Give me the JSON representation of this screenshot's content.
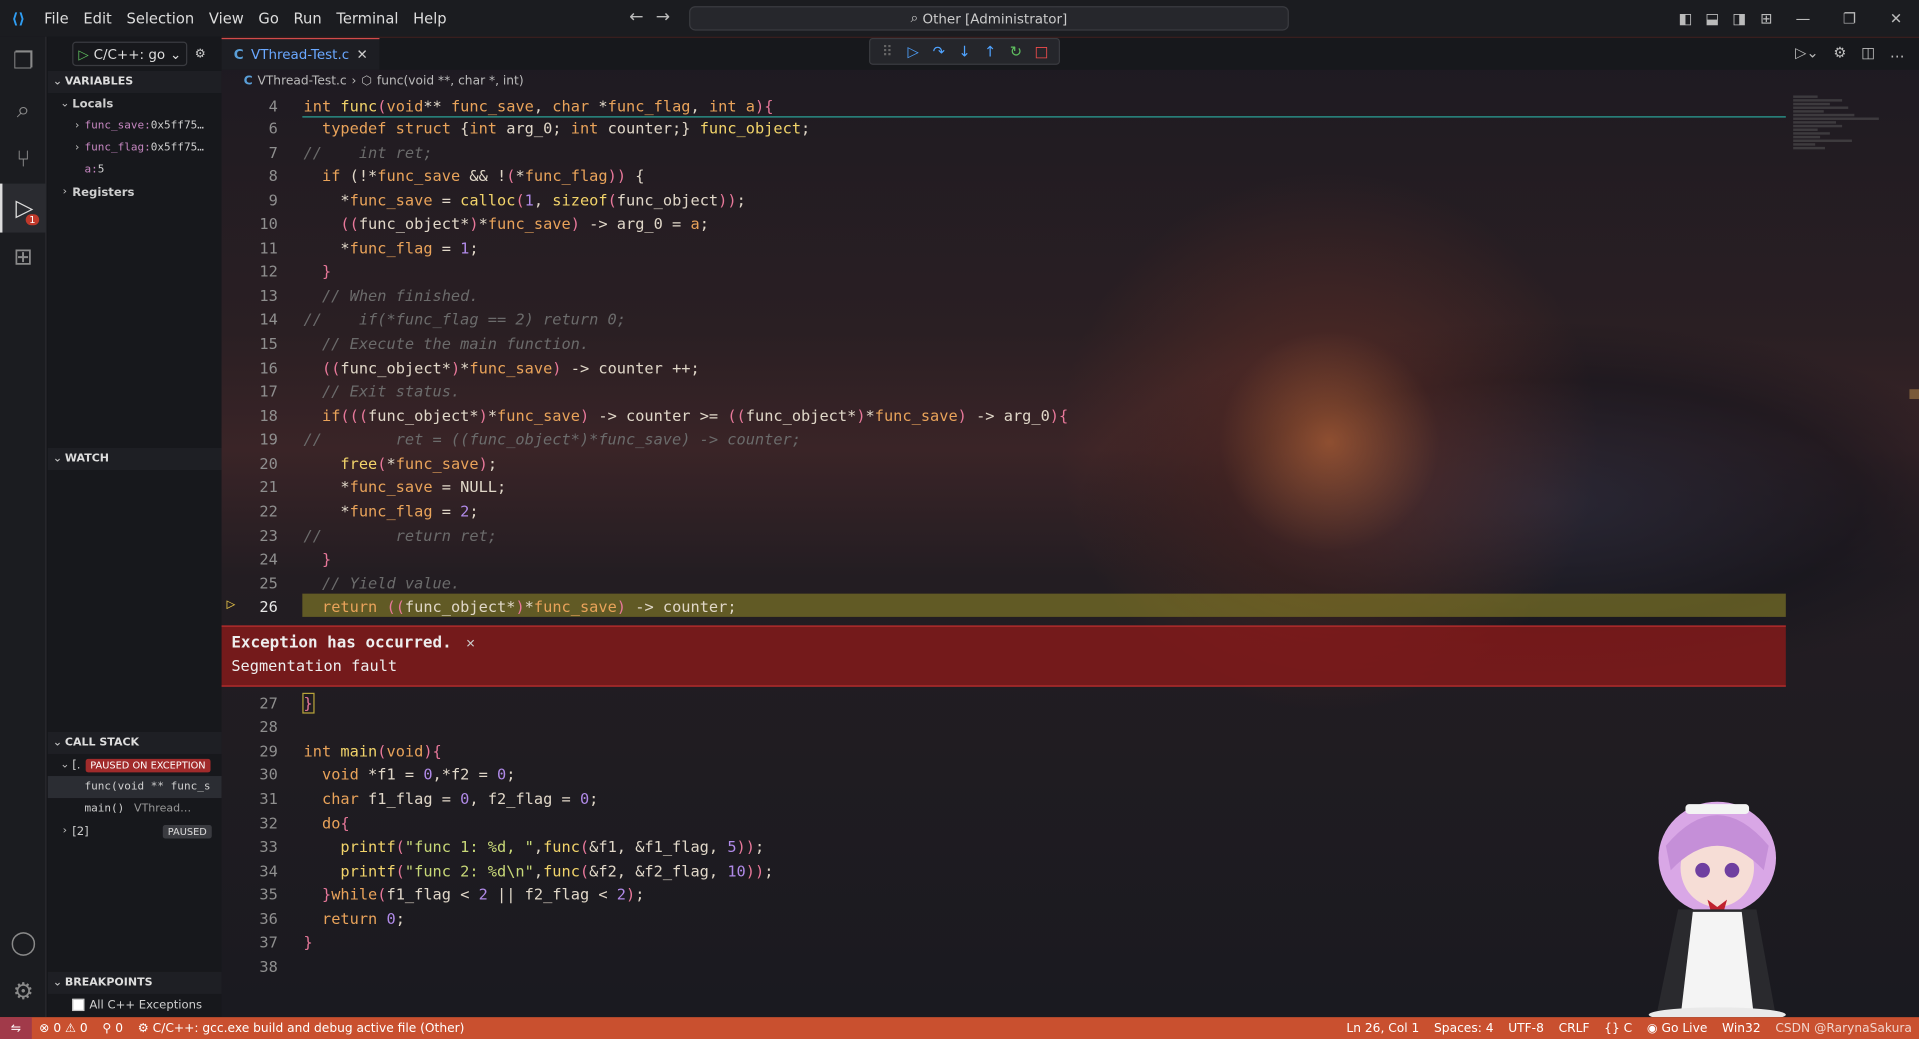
{
  "titlebar": {
    "menu": [
      "File",
      "Edit",
      "Selection",
      "View",
      "Go",
      "Run",
      "Terminal",
      "Help"
    ],
    "command_center": "Other [Administrator]"
  },
  "sidebar": {
    "run_config": "C/C++: go",
    "variables_header": "VARIABLES",
    "locals_label": "Locals",
    "vars": [
      {
        "name": "func_save:",
        "value": " 0x5ff75…"
      },
      {
        "name": "func_flag:",
        "value": " 0x5ff75…"
      },
      {
        "name": "a:",
        "value": " 5"
      }
    ],
    "registers_label": "Registers",
    "watch_header": "WATCH",
    "callstack_header": "CALL STACK",
    "thread1_label": "[.",
    "thread1_badge": "PAUSED ON EXCEPTION",
    "frame1": "func(void ** func_s",
    "frame2_name": "main()",
    "frame2_file": "VThread…",
    "thread2_label": "[2]",
    "thread2_badge": "PAUSED",
    "breakpoints_header": "BREAKPOINTS",
    "bp_all_cpp": "All C++ Exceptions"
  },
  "editor": {
    "tab_icon": "C",
    "tab_label": "VThread-Test.c",
    "breadcrumb_file": "VThread-Test.c",
    "breadcrumb_symbol": "func(void **, char *, int)",
    "current_line": 26,
    "exception_title": "Exception has occurred.",
    "exception_message": "Segmentation fault",
    "line_numbers_top": [
      "4",
      "6",
      "7",
      "8",
      "9",
      "10",
      "11",
      "12",
      "13",
      "14",
      "15",
      "16",
      "17",
      "18",
      "19",
      "20",
      "21",
      "22",
      "23",
      "24",
      "25",
      "26"
    ],
    "line_numbers_bottom": [
      "27",
      "28",
      "29",
      "30",
      "31",
      "32",
      "33",
      "34",
      "35",
      "36",
      "37",
      "38"
    ]
  },
  "statusbar": {
    "errors": "0",
    "warnings": "0",
    "ports": "0",
    "task": "C/C++: gcc.exe build and debug active file (Other)",
    "position": "Ln 26, Col 1",
    "spaces": "Spaces: 4",
    "encoding": "UTF-8",
    "eol": "CRLF",
    "language": "C",
    "golive": "Go Live",
    "platform": "Win32",
    "watermark": "CSDN @RarynaSakura"
  },
  "colors": {
    "statusbar": "#c9502f",
    "exception_bg": "#8c1919",
    "highlight_line": "#968c28"
  }
}
